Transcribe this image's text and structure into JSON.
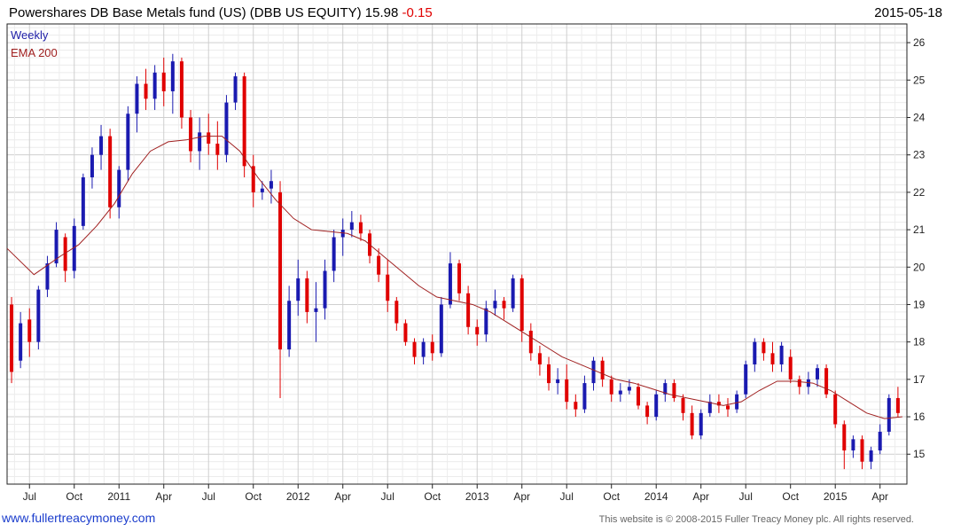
{
  "header": {
    "title_main": "Powershares DB Base Metals fund (US) (DBB US EQUITY) 15.98",
    "title_change": "-0.15",
    "date": "2015-05-18"
  },
  "legend": {
    "weekly": "Weekly",
    "ema": "EMA 200"
  },
  "footer": {
    "left": "www.fullertreacymoney.com",
    "right": "This website is © 2008-2015 Fuller Treacy Money plc. All rights reserved."
  },
  "colors": {
    "up": "#1a1ab0",
    "down": "#e00000",
    "ema": "#a02020",
    "grid": "#d8d8d8"
  },
  "chart_data": {
    "type": "candlestick",
    "frequency": "weekly",
    "ylim": [
      14.2,
      26.5
    ],
    "yticks": [
      15,
      16,
      17,
      18,
      19,
      20,
      21,
      22,
      23,
      24,
      25,
      26
    ],
    "xlim": [
      0,
      100.5
    ],
    "xticks": [
      {
        "label": "Jul",
        "x": 2.5
      },
      {
        "label": "Oct",
        "x": 7.5
      },
      {
        "label": "2011",
        "x": 12.5
      },
      {
        "label": "Apr",
        "x": 17.5
      },
      {
        "label": "Jul",
        "x": 22.5
      },
      {
        "label": "Oct",
        "x": 27.5
      },
      {
        "label": "2012",
        "x": 32.5
      },
      {
        "label": "Apr",
        "x": 37.5
      },
      {
        "label": "Jul",
        "x": 42.5
      },
      {
        "label": "Oct",
        "x": 47.5
      },
      {
        "label": "2013",
        "x": 52.5
      },
      {
        "label": "Apr",
        "x": 57.5
      },
      {
        "label": "Jul",
        "x": 62.5
      },
      {
        "label": "Oct",
        "x": 67.5
      },
      {
        "label": "2014",
        "x": 72.5
      },
      {
        "label": "Apr",
        "x": 77.5
      },
      {
        "label": "Jul",
        "x": 82.5
      },
      {
        "label": "Oct",
        "x": 87.5
      },
      {
        "label": "2015",
        "x": 92.5
      },
      {
        "label": "Apr",
        "x": 97.5
      }
    ],
    "ohlc": [
      [
        19.0,
        19.2,
        16.9,
        17.2
      ],
      [
        17.5,
        18.8,
        17.3,
        18.5
      ],
      [
        18.6,
        18.9,
        17.6,
        18.0
      ],
      [
        18.0,
        19.5,
        17.8,
        19.4
      ],
      [
        19.4,
        20.3,
        19.2,
        20.1
      ],
      [
        20.1,
        21.2,
        20.0,
        21.0
      ],
      [
        20.8,
        20.9,
        19.6,
        19.9
      ],
      [
        19.9,
        21.3,
        19.7,
        21.1
      ],
      [
        21.1,
        22.5,
        21.0,
        22.4
      ],
      [
        22.4,
        23.2,
        22.1,
        23.0
      ],
      [
        23.0,
        23.8,
        22.6,
        23.5
      ],
      [
        23.5,
        23.7,
        21.3,
        21.6
      ],
      [
        21.6,
        22.7,
        21.3,
        22.6
      ],
      [
        22.6,
        24.3,
        22.3,
        24.1
      ],
      [
        24.1,
        25.1,
        23.6,
        24.9
      ],
      [
        24.9,
        25.3,
        24.2,
        24.5
      ],
      [
        24.5,
        25.4,
        24.2,
        25.2
      ],
      [
        25.2,
        25.6,
        24.3,
        24.7
      ],
      [
        24.7,
        25.7,
        24.1,
        25.5
      ],
      [
        25.5,
        25.6,
        23.7,
        24.0
      ],
      [
        24.0,
        24.2,
        22.8,
        23.1
      ],
      [
        23.1,
        24.0,
        22.6,
        23.6
      ],
      [
        23.6,
        24.1,
        23.0,
        23.3
      ],
      [
        23.3,
        23.9,
        22.6,
        23.0
      ],
      [
        23.0,
        24.6,
        22.8,
        24.4
      ],
      [
        24.4,
        25.2,
        24.2,
        25.1
      ],
      [
        25.1,
        25.2,
        22.4,
        22.7
      ],
      [
        22.7,
        23.0,
        21.6,
        22.0
      ],
      [
        22.0,
        22.3,
        21.8,
        22.1
      ],
      [
        22.1,
        22.6,
        21.7,
        22.3
      ],
      [
        22.0,
        22.3,
        16.5,
        17.8
      ],
      [
        17.8,
        19.5,
        17.6,
        19.1
      ],
      [
        19.1,
        20.2,
        18.7,
        19.7
      ],
      [
        19.7,
        19.9,
        18.5,
        18.8
      ],
      [
        18.8,
        19.6,
        18.0,
        18.9
      ],
      [
        18.9,
        20.2,
        18.6,
        19.9
      ],
      [
        19.9,
        21.0,
        19.6,
        20.8
      ],
      [
        20.8,
        21.3,
        20.3,
        21.0
      ],
      [
        21.0,
        21.5,
        20.8,
        21.2
      ],
      [
        21.2,
        21.4,
        20.7,
        20.9
      ],
      [
        20.9,
        21.0,
        20.1,
        20.3
      ],
      [
        20.3,
        20.5,
        19.6,
        19.8
      ],
      [
        19.8,
        20.2,
        18.8,
        19.1
      ],
      [
        19.1,
        19.2,
        18.3,
        18.5
      ],
      [
        18.5,
        18.6,
        17.9,
        18.0
      ],
      [
        18.0,
        18.1,
        17.4,
        17.6
      ],
      [
        17.6,
        18.1,
        17.4,
        18.0
      ],
      [
        18.0,
        18.2,
        17.5,
        17.7
      ],
      [
        17.7,
        19.2,
        17.6,
        19.0
      ],
      [
        19.0,
        20.4,
        18.9,
        20.1
      ],
      [
        20.1,
        20.2,
        19.1,
        19.3
      ],
      [
        19.3,
        19.5,
        18.2,
        18.4
      ],
      [
        18.4,
        18.6,
        17.9,
        18.2
      ],
      [
        18.2,
        19.1,
        18.0,
        18.9
      ],
      [
        18.9,
        19.4,
        18.7,
        19.1
      ],
      [
        19.1,
        19.2,
        18.6,
        18.9
      ],
      [
        18.9,
        19.8,
        18.8,
        19.7
      ],
      [
        19.7,
        19.8,
        18.0,
        18.3
      ],
      [
        18.3,
        18.5,
        17.5,
        17.7
      ],
      [
        17.7,
        17.9,
        17.1,
        17.4
      ],
      [
        17.4,
        17.6,
        16.7,
        16.9
      ],
      [
        16.9,
        17.3,
        16.6,
        17.0
      ],
      [
        17.0,
        17.4,
        16.2,
        16.4
      ],
      [
        16.4,
        16.6,
        16.0,
        16.2
      ],
      [
        16.2,
        17.1,
        16.1,
        16.9
      ],
      [
        16.9,
        17.6,
        16.7,
        17.5
      ],
      [
        17.5,
        17.6,
        16.8,
        17.0
      ],
      [
        17.0,
        17.1,
        16.4,
        16.6
      ],
      [
        16.6,
        16.9,
        16.4,
        16.7
      ],
      [
        16.7,
        17.0,
        16.6,
        16.8
      ],
      [
        16.8,
        16.9,
        16.2,
        16.3
      ],
      [
        16.3,
        16.4,
        15.8,
        16.0
      ],
      [
        16.0,
        16.7,
        15.9,
        16.6
      ],
      [
        16.6,
        17.0,
        16.4,
        16.9
      ],
      [
        16.9,
        17.0,
        16.4,
        16.5
      ],
      [
        16.5,
        16.6,
        15.9,
        16.1
      ],
      [
        16.1,
        16.3,
        15.4,
        15.5
      ],
      [
        15.5,
        16.2,
        15.4,
        16.1
      ],
      [
        16.1,
        16.6,
        16.0,
        16.4
      ],
      [
        16.4,
        16.6,
        16.1,
        16.3
      ],
      [
        16.3,
        16.5,
        16.0,
        16.2
      ],
      [
        16.2,
        16.7,
        16.1,
        16.6
      ],
      [
        16.6,
        17.5,
        16.5,
        17.4
      ],
      [
        17.4,
        18.1,
        17.2,
        18.0
      ],
      [
        18.0,
        18.1,
        17.5,
        17.7
      ],
      [
        17.7,
        18.0,
        17.2,
        17.4
      ],
      [
        17.4,
        18.0,
        17.2,
        17.9
      ],
      [
        17.6,
        17.8,
        16.9,
        17.0
      ],
      [
        17.0,
        17.1,
        16.6,
        16.8
      ],
      [
        16.8,
        17.2,
        16.6,
        17.0
      ],
      [
        17.0,
        17.4,
        16.8,
        17.3
      ],
      [
        17.3,
        17.4,
        16.5,
        16.6
      ],
      [
        16.6,
        16.7,
        15.7,
        15.8
      ],
      [
        15.8,
        15.9,
        14.6,
        15.1
      ],
      [
        15.1,
        15.5,
        14.9,
        15.4
      ],
      [
        15.4,
        15.5,
        14.6,
        14.8
      ],
      [
        14.8,
        15.2,
        14.6,
        15.1
      ],
      [
        15.1,
        15.8,
        15.0,
        15.6
      ],
      [
        15.6,
        16.6,
        15.5,
        16.5
      ],
      [
        16.5,
        16.8,
        16.0,
        16.1
      ]
    ],
    "ema200": [
      [
        0,
        20.5
      ],
      [
        3,
        19.8
      ],
      [
        6,
        20.3
      ],
      [
        8,
        20.6
      ],
      [
        10,
        21.1
      ],
      [
        12,
        21.7
      ],
      [
        14,
        22.5
      ],
      [
        16,
        23.1
      ],
      [
        18,
        23.35
      ],
      [
        20,
        23.4
      ],
      [
        22,
        23.5
      ],
      [
        24,
        23.5
      ],
      [
        26,
        23.1
      ],
      [
        28,
        22.4
      ],
      [
        30,
        21.8
      ],
      [
        32,
        21.3
      ],
      [
        34,
        21.0
      ],
      [
        36,
        20.95
      ],
      [
        38,
        20.9
      ],
      [
        40,
        20.7
      ],
      [
        42,
        20.3
      ],
      [
        44,
        19.9
      ],
      [
        46,
        19.5
      ],
      [
        48,
        19.2
      ],
      [
        50,
        19.1
      ],
      [
        52,
        19.0
      ],
      [
        54,
        18.8
      ],
      [
        56,
        18.5
      ],
      [
        58,
        18.2
      ],
      [
        60,
        17.9
      ],
      [
        62,
        17.6
      ],
      [
        64,
        17.4
      ],
      [
        66,
        17.2
      ],
      [
        68,
        17.0
      ],
      [
        70,
        16.9
      ],
      [
        72,
        16.75
      ],
      [
        74,
        16.6
      ],
      [
        76,
        16.5
      ],
      [
        78,
        16.4
      ],
      [
        80,
        16.3
      ],
      [
        82,
        16.4
      ],
      [
        84,
        16.7
      ],
      [
        86,
        16.95
      ],
      [
        88,
        16.95
      ],
      [
        90,
        16.9
      ],
      [
        92,
        16.7
      ],
      [
        94,
        16.4
      ],
      [
        96,
        16.1
      ],
      [
        98,
        15.95
      ],
      [
        100,
        16.0
      ]
    ]
  }
}
